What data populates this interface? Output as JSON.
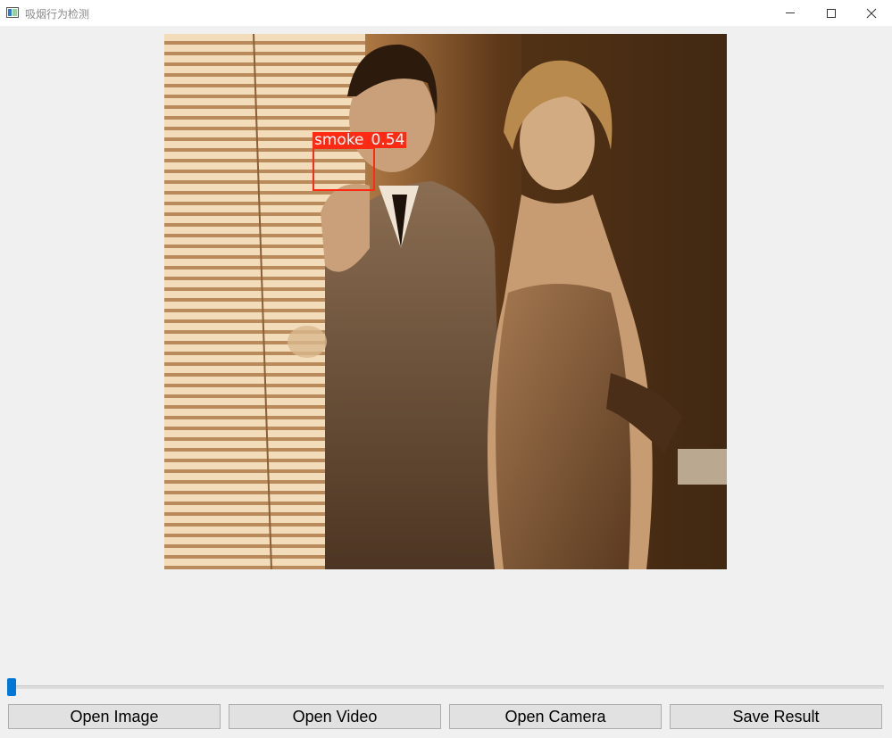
{
  "window": {
    "title": "吸烟行为检测",
    "icon": "app-window-icon",
    "controls": [
      "minimize-icon",
      "maximize-icon",
      "close-icon"
    ]
  },
  "detection": {
    "label": "smoke",
    "score": "0.54",
    "color": "#ff2a14"
  },
  "slider": {
    "value": 0,
    "accent": "#0078d7"
  },
  "buttons": {
    "open_image": "Open Image",
    "open_video": "Open Video",
    "open_camera": "Open Camera",
    "save_result": "Save Result"
  }
}
